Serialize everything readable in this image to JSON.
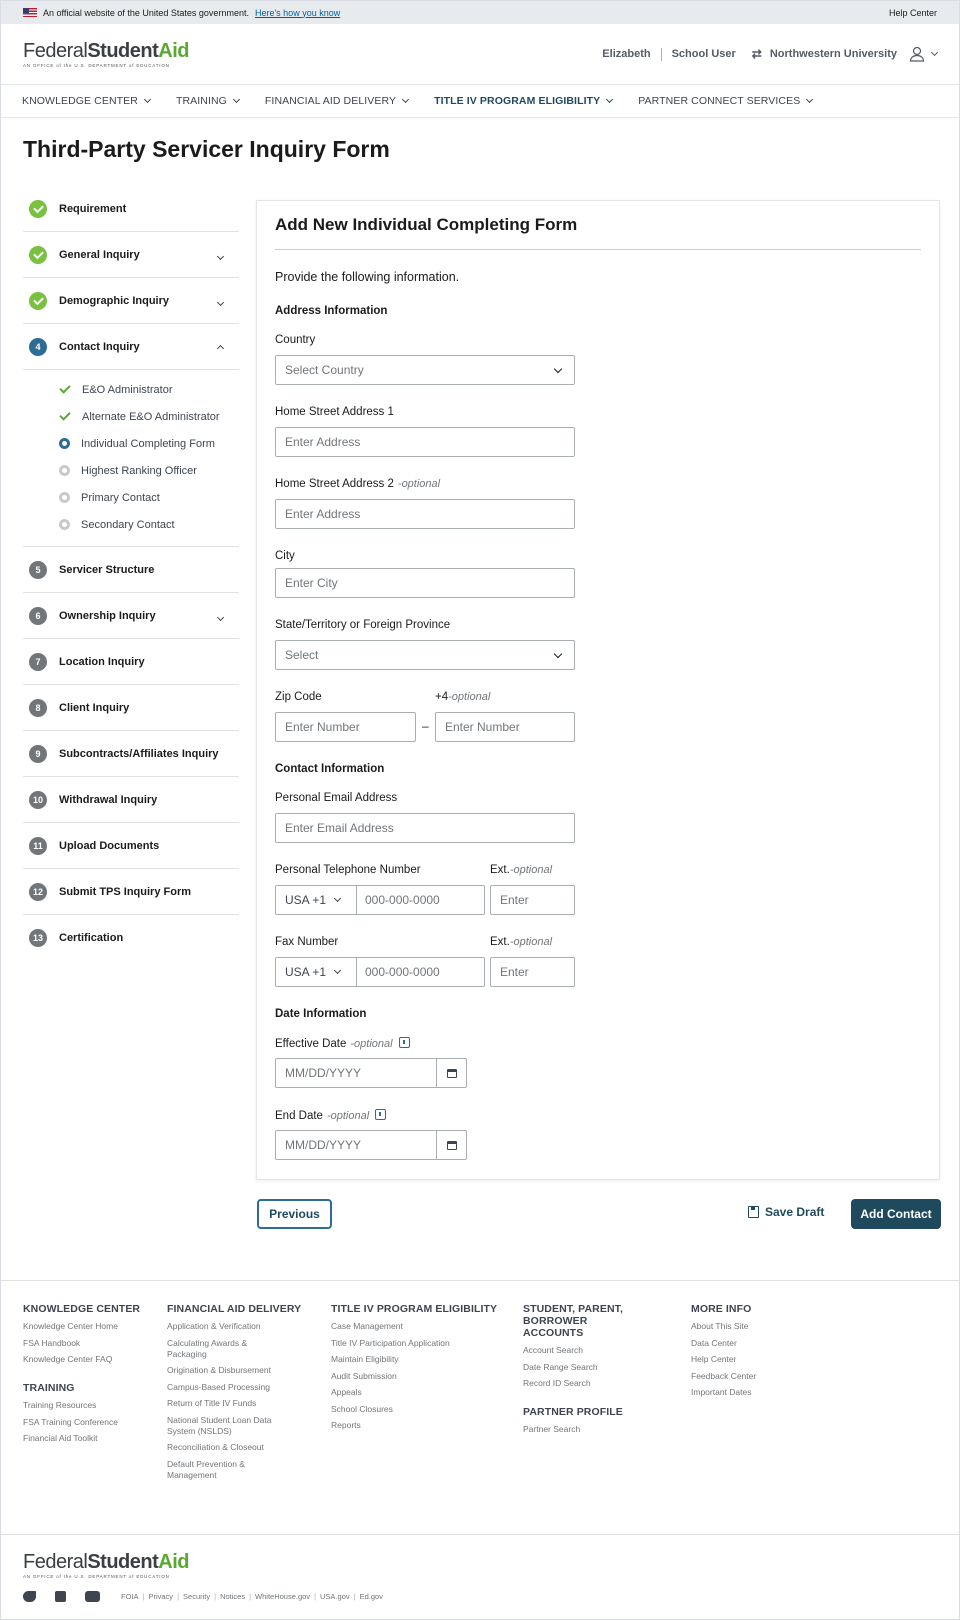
{
  "banner": {
    "text": "An official website of the United States government.",
    "link": "Here's how you know",
    "help": "Help Center"
  },
  "logo": {
    "part1": "Federal",
    "part2": "Student",
    "part3": "Aid",
    "sub": "AN OFFICE of the U.S. DEPARTMENT of EDUCATION"
  },
  "user": {
    "name": "Elizabeth",
    "role": "School User",
    "institution": "Northwestern University"
  },
  "nav": [
    {
      "label": "KNOWLEDGE CENTER"
    },
    {
      "label": "TRAINING"
    },
    {
      "label": "FINANCIAL AID DELIVERY"
    },
    {
      "label": "TITLE IV PROGRAM ELIGIBILITY"
    },
    {
      "label": "PARTNER CONNECT SERVICES"
    }
  ],
  "page_title": "Third-Party Servicer Inquiry Form",
  "steps": {
    "s1": {
      "label": "Requirement"
    },
    "s2": {
      "label": "General Inquiry"
    },
    "s3": {
      "label": "Demographic Inquiry"
    },
    "s4": {
      "num": "4",
      "label": "Contact Inquiry"
    },
    "subs": [
      {
        "label": "E&O Administrator"
      },
      {
        "label": "Alternate E&O Administrator"
      },
      {
        "label": "Individual Completing Form"
      },
      {
        "label": "Highest Ranking Officer"
      },
      {
        "label": "Primary Contact"
      },
      {
        "label": "Secondary Contact"
      }
    ],
    "rest": [
      {
        "num": "5",
        "label": "Servicer Structure"
      },
      {
        "num": "6",
        "label": "Ownership Inquiry"
      },
      {
        "num": "7",
        "label": "Location Inquiry"
      },
      {
        "num": "8",
        "label": "Client Inquiry"
      },
      {
        "num": "9",
        "label": "Subcontracts/Affiliates Inquiry"
      },
      {
        "num": "10",
        "label": "Withdrawal Inquiry"
      },
      {
        "num": "11",
        "label": "Upload Documents"
      },
      {
        "num": "12",
        "label": "Submit TPS Inquiry Form"
      },
      {
        "num": "13",
        "label": "Certification"
      }
    ]
  },
  "form": {
    "title": "Add New Individual Completing Form",
    "intro": "Provide the following information.",
    "address_heading": "Address Information",
    "optional": "-optional",
    "country": {
      "label": "Country",
      "placeholder": "Select Country"
    },
    "addr1": {
      "label": "Home Street Address 1",
      "placeholder": "Enter Address"
    },
    "addr2": {
      "label": "Home Street Address 2",
      "placeholder": "Enter Address"
    },
    "city": {
      "label": "City",
      "placeholder": "Enter City"
    },
    "state": {
      "label": "State/Territory or Foreign Province",
      "placeholder": "Select"
    },
    "zip": {
      "label": "Zip Code",
      "placeholder": "Enter Number",
      "plus4_label": "+4",
      "plus4_placeholder": "Enter Number",
      "dash": "–"
    },
    "contact_heading": "Contact Information",
    "email": {
      "label": "Personal Email Address",
      "placeholder": "Enter Email Address"
    },
    "phone": {
      "label": "Personal Telephone Number",
      "code": "USA +1",
      "placeholder": "000-000-0000",
      "ext_label": "Ext.",
      "ext_placeholder": "Enter"
    },
    "fax": {
      "label": "Fax Number",
      "code": "USA +1",
      "placeholder": "000-000-0000",
      "ext_label": "Ext.",
      "ext_placeholder": "Enter"
    },
    "date_heading": "Date Information",
    "effective": {
      "label": "Effective Date",
      "placeholder": "MM/DD/YYYY"
    },
    "end": {
      "label": "End Date",
      "placeholder": "MM/DD/YYYY"
    }
  },
  "actions": {
    "previous": "Previous",
    "save_draft": "Save Draft",
    "add_contact": "Add Contact"
  },
  "footer": {
    "kc": {
      "heading": "KNOWLEDGE CENTER",
      "links": [
        "Knowledge Center Home",
        "FSA Handbook",
        "Knowledge Center FAQ"
      ]
    },
    "training": {
      "heading": "TRAINING",
      "links": [
        "Training Resources",
        "FSA Training Conference",
        "Financial Aid Toolkit"
      ]
    },
    "fad": {
      "heading": "FINANCIAL AID DELIVERY",
      "links": [
        "Application & Verification",
        "Calculating Awards & Packaging",
        "Origination & Disbursement",
        "Campus-Based Processing",
        "Return of Title IV Funds",
        "National Student Loan Data System (NSLDS)",
        "Reconciliation & Closeout",
        "Default Prevention & Management"
      ]
    },
    "t4": {
      "heading": "TITLE IV PROGRAM ELIGIBILITY",
      "links": [
        "Case Management",
        "Title IV Participation Application",
        "Maintain Eligibility",
        "Audit Submission",
        "Appeals",
        "School Closures",
        "Reports"
      ]
    },
    "spb": {
      "heading": "STUDENT, PARENT, BORROWER ACCOUNTS",
      "links": [
        "Account Search",
        "Date Range Search",
        "Record ID Search"
      ]
    },
    "pp": {
      "heading": "PARTNER PROFILE",
      "links": [
        "Partner Search"
      ]
    },
    "more": {
      "heading": "MORE INFO",
      "links": [
        "About This Site",
        "Data Center",
        "Help Center",
        "Feedback Center",
        "Important Dates"
      ]
    },
    "bottom_links": [
      "FOIA",
      "Privacy",
      "Security",
      "Notices",
      "WhiteHouse.gov",
      "USA.gov",
      "Ed.gov"
    ]
  },
  "icons": {
    "brand_green": "#5aa832",
    "primary": "#1f4a5e",
    "done_green": "#7ac142",
    "step_blue": "#2e6c96"
  }
}
